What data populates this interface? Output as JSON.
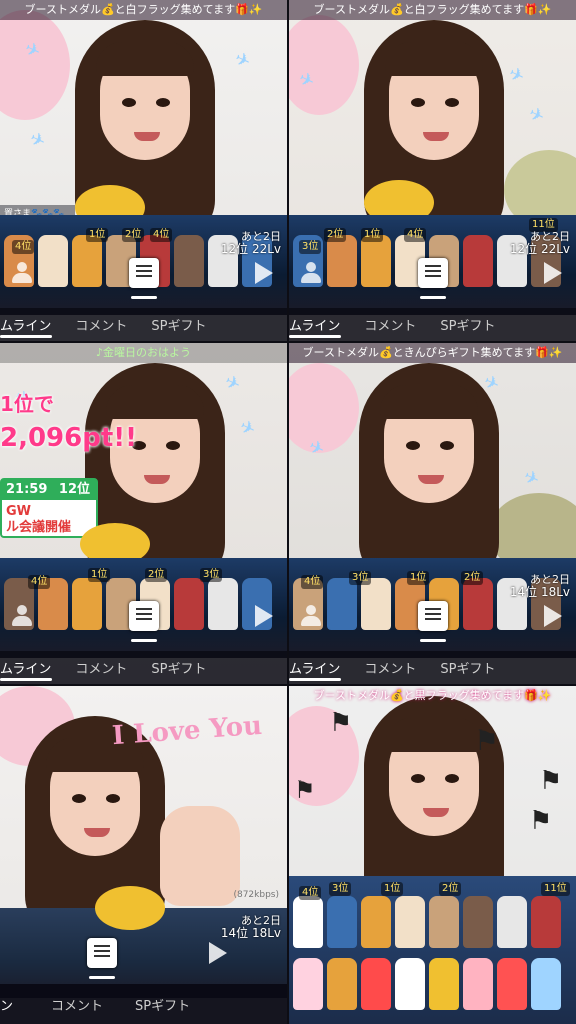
{
  "tiles": [
    {
      "banner": "ブーストメダル💰と白フラッグ集めてます🎁✨",
      "tabs": {
        "timeline": "ムライン",
        "comment": "コメント",
        "gift": "SPギフト"
      },
      "info": {
        "days": "あと2日",
        "rank": "12位",
        "level": "22Lv"
      },
      "ranks": [
        "4位",
        "1位",
        "4位",
        "2位"
      ],
      "overlay_texts": [
        "置さま🐾🐾🐾🐾"
      ],
      "colors": {
        "bg": "#f1f0ef",
        "accent": "#ffd84a"
      }
    },
    {
      "banner": "ブーストメダル💰と白フラッグ集めてます🎁✨",
      "tabs": {
        "timeline": "ムライン",
        "comment": "コメント",
        "gift": "SPギフト"
      },
      "info": {
        "days": "あと2日",
        "rank": "12位",
        "level": "22Lv"
      },
      "ranks": [
        "3位",
        "1位",
        "4位",
        "2位",
        "11位"
      ],
      "colors": {
        "bg": "#efece8",
        "accent": "#9fd4ff"
      }
    },
    {
      "banner": "♪金曜日のおはよう",
      "tabs": {
        "timeline": "ムライン",
        "comment": "コメント",
        "gift": "SPギフト"
      },
      "info": {
        "days": "",
        "rank": "",
        "level": ""
      },
      "ranks": [
        "4位",
        "1位",
        "2位",
        "3位"
      ],
      "overlay_texts": [
        "1位で",
        "2,096pt!!",
        "21:59",
        "12位",
        "GW",
        "ル会議開催"
      ],
      "colors": {
        "bg": "#ece9e6",
        "accent": "#ff3a8a"
      }
    },
    {
      "banner": "ブーストメダル💰ときんぴらギフト集めてます🎁✨",
      "tabs": {
        "timeline": "ムライン",
        "comment": "コメント",
        "gift": "SPギフト"
      },
      "info": {
        "days": "あと2日",
        "rank": "14位",
        "level": "18Lv"
      },
      "ranks": [
        "4位",
        "3位",
        "1位",
        "2位"
      ],
      "colors": {
        "bg": "#e8e6e3",
        "accent": "#9fd4ff"
      }
    },
    {
      "banner": "",
      "tabs": {
        "timeline": "ン",
        "comment": "コメント",
        "gift": "SPギフト"
      },
      "info": {
        "days": "あと2日",
        "rank": "14位",
        "level": "18Lv"
      },
      "ranks": [],
      "overlay_texts": [
        "I Love You",
        "(872kbps)"
      ],
      "colors": {
        "bg": "#f3f1f0",
        "accent": "#ff7fb0"
      }
    },
    {
      "banner": "ブーストメダル💰と黒フラッグ集めてます🎁✨",
      "tabs": {
        "timeline": "",
        "comment": "",
        "gift": ""
      },
      "info": {
        "days": "",
        "rank": "",
        "level": ""
      },
      "ranks": [
        "4位",
        "3位",
        "1位",
        "2位",
        "11位"
      ],
      "colors": {
        "bg": "#efefef",
        "accent": "#333333"
      }
    }
  ]
}
